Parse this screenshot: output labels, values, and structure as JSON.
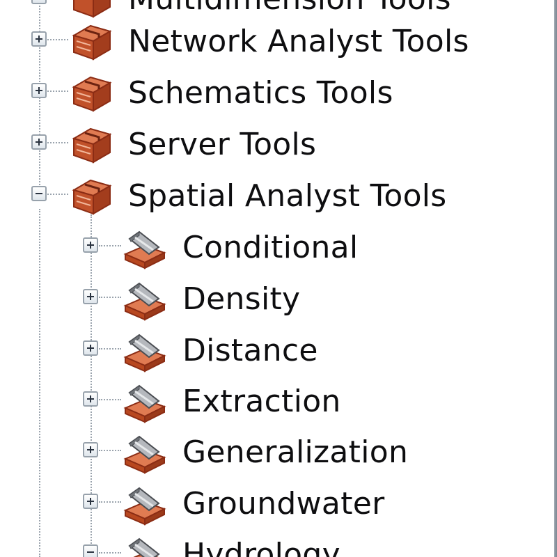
{
  "tree": {
    "top_partial_label": "Multidimension Tools",
    "toolboxes": [
      {
        "label": "Network Analyst Tools",
        "state": "collapsed"
      },
      {
        "label": "Schematics Tools",
        "state": "collapsed"
      },
      {
        "label": "Server Tools",
        "state": "collapsed"
      },
      {
        "label": "Spatial Analyst Tools",
        "state": "expanded"
      }
    ],
    "toolsets": [
      {
        "label": "Conditional",
        "state": "collapsed"
      },
      {
        "label": "Density",
        "state": "collapsed"
      },
      {
        "label": "Distance",
        "state": "collapsed"
      },
      {
        "label": "Extraction",
        "state": "collapsed"
      },
      {
        "label": "Generalization",
        "state": "collapsed"
      },
      {
        "label": "Groundwater",
        "state": "collapsed"
      },
      {
        "label": "Hydrology",
        "state": "expanded"
      }
    ]
  },
  "icons": {
    "toolbox": "toolbox-icon",
    "toolset": "toolset-icon",
    "expand": "expand-plus-icon",
    "collapse": "collapse-minus-icon"
  },
  "colors": {
    "toolbox_red": "#c1512a",
    "toolset_gray": "#8c8f94",
    "tree_line": "#9aa3ad",
    "text": "#0e0e10"
  }
}
